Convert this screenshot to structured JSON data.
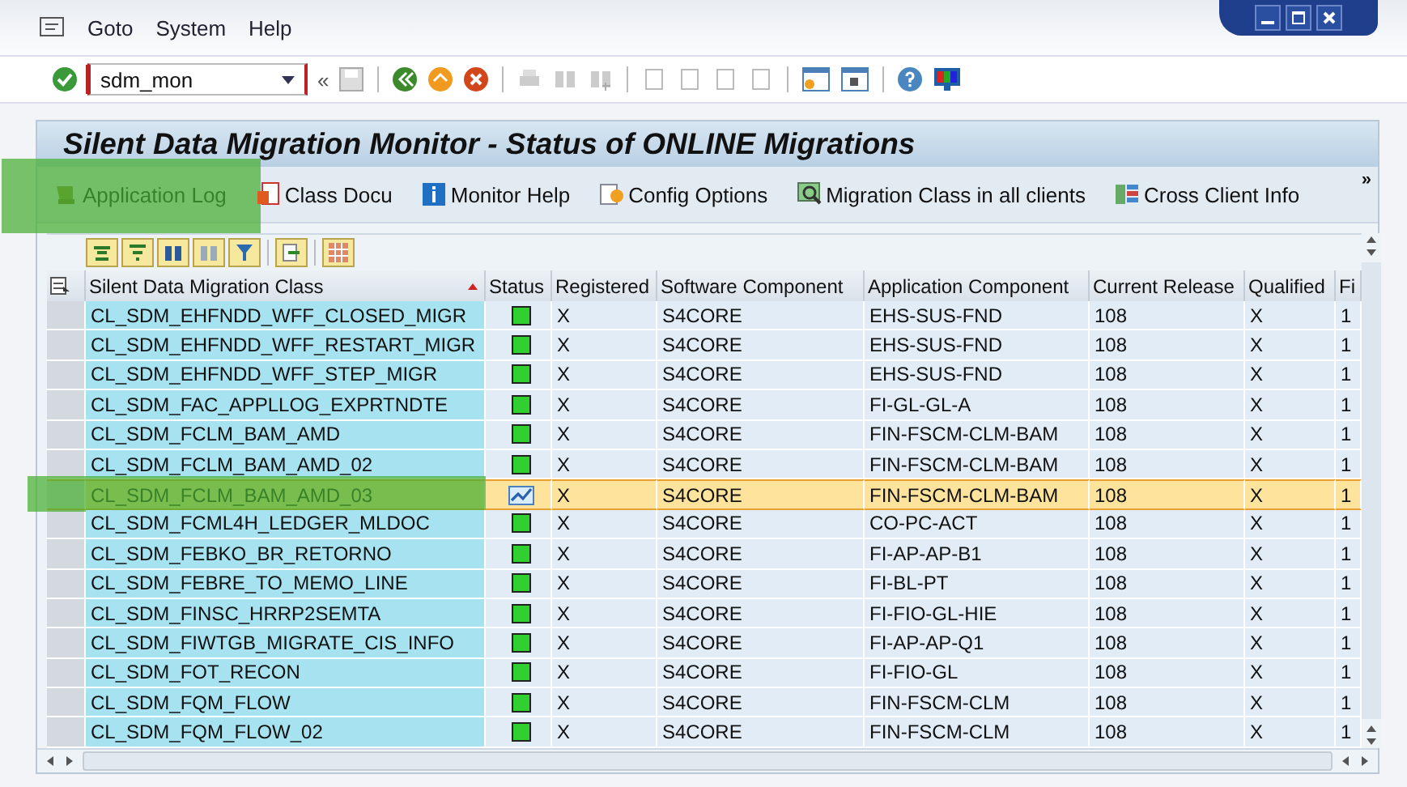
{
  "menu": [
    {
      "label": "Goto"
    },
    {
      "label": "System"
    },
    {
      "label": "Help"
    }
  ],
  "command_field": {
    "value": "sdm_mon"
  },
  "toolbar_chevron": "«",
  "title": "Silent Data Migration Monitor - Status of ONLINE Migrations",
  "app_toolbar": {
    "buttons": [
      {
        "label": "Application Log",
        "kind": "log",
        "highlighted": true
      },
      {
        "label": "Class Docu",
        "kind": "doc",
        "highlighted": false
      },
      {
        "label": "Monitor Help",
        "kind": "info",
        "highlighted": false
      },
      {
        "label": "Config Options",
        "kind": "config",
        "highlighted": false
      },
      {
        "label": "Migration Class in all clients",
        "kind": "search",
        "highlighted": false
      },
      {
        "label": "Cross Client Info",
        "kind": "list",
        "highlighted": false
      }
    ],
    "more": "»"
  },
  "table": {
    "columns": [
      "Silent Data Migration Class",
      "Status",
      "Registered",
      "Software Component",
      "Application Component",
      "Current Release",
      "Qualified",
      "Fi"
    ],
    "rows": [
      {
        "migration_class": "CL_SDM_EHFNDD_WFF_CLOSED_MIGR",
        "kind": "ok",
        "registered": "X",
        "software_component": "S4CORE",
        "application_component": "EHS-SUS-FND",
        "current_release": "108",
        "qualified": "X",
        "column_8": "1",
        "selected": false,
        "highlighted": false
      },
      {
        "migration_class": "CL_SDM_EHFNDD_WFF_RESTART_MIGR",
        "kind": "ok",
        "registered": "X",
        "software_component": "S4CORE",
        "application_component": "EHS-SUS-FND",
        "current_release": "108",
        "qualified": "X",
        "column_8": "1",
        "selected": false,
        "highlighted": false
      },
      {
        "migration_class": "CL_SDM_EHFNDD_WFF_STEP_MIGR",
        "kind": "ok",
        "registered": "X",
        "software_component": "S4CORE",
        "application_component": "EHS-SUS-FND",
        "current_release": "108",
        "qualified": "X",
        "column_8": "1",
        "selected": false,
        "highlighted": false
      },
      {
        "migration_class": "CL_SDM_FAC_APPLLOG_EXPRTNDTE",
        "kind": "ok",
        "registered": "X",
        "software_component": "S4CORE",
        "application_component": "FI-GL-GL-A",
        "current_release": "108",
        "qualified": "X",
        "column_8": "1",
        "selected": false,
        "highlighted": false
      },
      {
        "migration_class": "CL_SDM_FCLM_BAM_AMD",
        "kind": "ok",
        "registered": "X",
        "software_component": "S4CORE",
        "application_component": "FIN-FSCM-CLM-BAM",
        "current_release": "108",
        "qualified": "X",
        "column_8": "1",
        "selected": false,
        "highlighted": false
      },
      {
        "migration_class": "CL_SDM_FCLM_BAM_AMD_02",
        "kind": "ok",
        "registered": "X",
        "software_component": "S4CORE",
        "application_component": "FIN-FSCM-CLM-BAM",
        "current_release": "108",
        "qualified": "X",
        "column_8": "1",
        "selected": false,
        "highlighted": false
      },
      {
        "migration_class": "CL_SDM_FCLM_BAM_AMD_03",
        "kind": "trend",
        "registered": "X",
        "software_component": "S4CORE",
        "application_component": "FIN-FSCM-CLM-BAM",
        "current_release": "108",
        "qualified": "X",
        "column_8": "1",
        "selected": true,
        "highlighted": true
      },
      {
        "migration_class": "CL_SDM_FCML4H_LEDGER_MLDOC",
        "kind": "ok",
        "registered": "X",
        "software_component": "S4CORE",
        "application_component": "CO-PC-ACT",
        "current_release": "108",
        "qualified": "X",
        "column_8": "1",
        "selected": false,
        "highlighted": false
      },
      {
        "migration_class": "CL_SDM_FEBKO_BR_RETORNO",
        "kind": "ok",
        "registered": "X",
        "software_component": "S4CORE",
        "application_component": "FI-AP-AP-B1",
        "current_release": "108",
        "qualified": "X",
        "column_8": "1",
        "selected": false,
        "highlighted": false
      },
      {
        "migration_class": "CL_SDM_FEBRE_TO_MEMO_LINE",
        "kind": "ok",
        "registered": "X",
        "software_component": "S4CORE",
        "application_component": "FI-BL-PT",
        "current_release": "108",
        "qualified": "X",
        "column_8": "1",
        "selected": false,
        "highlighted": false
      },
      {
        "migration_class": "CL_SDM_FINSC_HRRP2SEMTA",
        "kind": "ok",
        "registered": "X",
        "software_component": "S4CORE",
        "application_component": "FI-FIO-GL-HIE",
        "current_release": "108",
        "qualified": "X",
        "column_8": "1",
        "selected": false,
        "highlighted": false
      },
      {
        "migration_class": "CL_SDM_FIWTGB_MIGRATE_CIS_INFO",
        "kind": "ok",
        "registered": "X",
        "software_component": "S4CORE",
        "application_component": "FI-AP-AP-Q1",
        "current_release": "108",
        "qualified": "X",
        "column_8": "1",
        "selected": false,
        "highlighted": false
      },
      {
        "migration_class": "CL_SDM_FOT_RECON",
        "kind": "ok",
        "registered": "X",
        "software_component": "S4CORE",
        "application_component": "FI-FIO-GL",
        "current_release": "108",
        "qualified": "X",
        "column_8": "1",
        "selected": false,
        "highlighted": false
      },
      {
        "migration_class": "CL_SDM_FQM_FLOW",
        "kind": "ok",
        "registered": "X",
        "software_component": "S4CORE",
        "application_component": "FIN-FSCM-CLM",
        "current_release": "108",
        "qualified": "X",
        "column_8": "1",
        "selected": false,
        "highlighted": false
      },
      {
        "migration_class": "CL_SDM_FQM_FLOW_02",
        "kind": "ok",
        "registered": "X",
        "software_component": "S4CORE",
        "application_component": "FIN-FSCM-CLM",
        "current_release": "108",
        "qualified": "X",
        "column_8": "1",
        "selected": false,
        "highlighted": false
      }
    ]
  }
}
